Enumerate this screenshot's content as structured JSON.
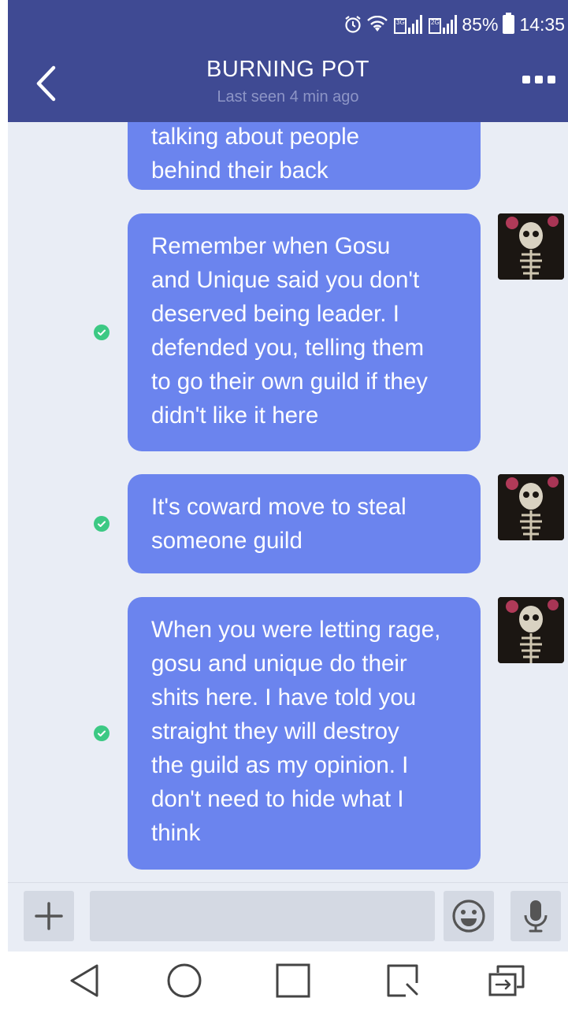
{
  "status_bar": {
    "battery_percent": "85%",
    "time": "14:35",
    "network_labels": [
      "3G",
      "2G"
    ],
    "icons": [
      "alarm-icon",
      "wifi-icon",
      "signal-icon",
      "signal-icon",
      "battery-icon"
    ]
  },
  "header": {
    "title": "BURNING POT",
    "subtitle": "Last seen 4 min ago",
    "back_icon": "chevron-left-icon",
    "menu_icon": "more-icon"
  },
  "messages": [
    {
      "lines": [
        "talking about people",
        "behind their back"
      ],
      "status": "delivered",
      "avatar": false
    },
    {
      "lines": [
        "Remember when Gosu",
        "and Unique said you don't",
        "deserved being leader. I",
        "defended you, telling them",
        "to go their own guild if they",
        "didn't like it here"
      ],
      "status": "read",
      "avatar": true
    },
    {
      "lines": [
        "It's coward move to steal",
        "someone guild"
      ],
      "status": "read",
      "avatar": true
    },
    {
      "lines": [
        "When you were letting rage,",
        "gosu and unique do their",
        "shits here. I have told you",
        "straight they will destroy",
        "the guild as my opinion. I",
        "don't need to hide what I",
        "think"
      ],
      "status": "read",
      "avatar": true
    }
  ],
  "input_bar": {
    "placeholder": "",
    "icons": [
      "plus-icon",
      "emoji-icon",
      "microphone-icon"
    ]
  },
  "nav_bar": {
    "icons": [
      "back-triangle-icon",
      "home-circle-icon",
      "recents-square-icon",
      "screen-capture-icon",
      "dual-window-icon"
    ]
  },
  "colors": {
    "header_bg": "#3f4a93",
    "bubble_bg": "#6b84ee",
    "chat_bg": "#e9edf5",
    "check_green": "#3cc984"
  }
}
